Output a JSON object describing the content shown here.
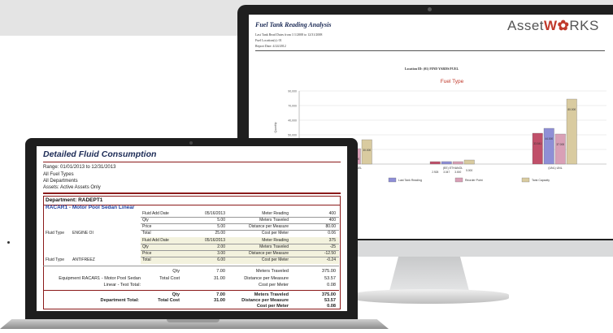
{
  "monitor": {
    "report": {
      "title": "Fuel Tank Reading Analysis",
      "meta": [
        "Last Tank Read Dates from 1/1/2008 to 12/31/2008",
        "Fuel Location(s): 01",
        "Report Date: 4/24/2012"
      ],
      "location": "Location ID: (01) FIND YARDS/FUEL",
      "logo_prefix": "Asset",
      "logo_w": "W",
      "logo_suffix": "RKS"
    },
    "chart_data": {
      "type": "bar",
      "title": "Fuel Type",
      "ylabel": "Quantity",
      "ylim": [
        0,
        90000
      ],
      "yticks": [
        "90,000",
        "70,000",
        "40,000",
        "50,000",
        "30,000"
      ],
      "categories": [
        "(BD) BIO-DIESEL",
        "(EE) ETHANOL",
        "(UNL) UNL"
      ],
      "series": [
        {
          "name": "Quantity on Hand",
          "color": "#c0506a",
          "values": [
            22000,
            3000,
            38000
          ]
        },
        {
          "name": "Last Tank Reading",
          "color": "#8f8fd6",
          "values": [
            24000,
            3047,
            44000
          ]
        },
        {
          "name": "Reorder Point",
          "color": "#d9a0b6",
          "values": [
            19000,
            3000,
            37000
          ]
        },
        {
          "name": "Tank Capacity",
          "color": "#d9cba0",
          "values": [
            30000,
            5000,
            80000
          ]
        }
      ],
      "data_labels": [
        [
          "",
          "4.504",
          "18.000",
          "30.000"
        ],
        [
          "2.928",
          "3.047",
          "3.000",
          "5.000"
        ],
        [
          "33.541",
          "44.000",
          "37.000",
          "80.000"
        ]
      ]
    }
  },
  "laptop": {
    "title": "Detailed Fluid Consumption",
    "range": "Range: 01/01/2013 to 12/31/2013",
    "fuel_types": "All Fuel Types",
    "departments": "All Departments",
    "assets": "Assets:  Active Assets Only",
    "department": "Department:  RADEPT1",
    "equipment": "RACAR1 - Motor Pool Sedan Linear",
    "block1": {
      "rows": [
        [
          "Fluid Add Date",
          "05/16/2013",
          "Meter Reading",
          "400"
        ],
        [
          "Qty",
          "5.00",
          "Meters Traveled",
          "400"
        ],
        [
          "Price",
          "5.00",
          "Distance per Measure",
          "80.00"
        ],
        [
          "Total",
          "25.00",
          "Cost per Meter",
          "0.06"
        ]
      ],
      "fluid_type_label": "Fluid Type",
      "fluid_type": "ENGINE OI"
    },
    "block2": {
      "rows": [
        [
          "Fluid Add Date",
          "05/16/2013",
          "Meter Reading",
          "375"
        ],
        [
          "Qty",
          "2.00",
          "Meters Traveled",
          "-25"
        ],
        [
          "Price",
          "3.00",
          "Distance per Measure",
          "-12.50"
        ],
        [
          "Total",
          "6.00",
          "Cost per Meter",
          "-0.24"
        ]
      ],
      "fluid_type_label": "Fluid Type",
      "fluid_type": "ANTIFREEZ"
    },
    "equip_total": {
      "label_line1": "Equipment RACAR1 - Motor Pool Sedan",
      "label_line2": "Linear - Test Total:",
      "rows": [
        [
          "Qty",
          "7.00",
          "Meters Traveled",
          "375.00"
        ],
        [
          "Total Cost",
          "31.00",
          "Distance per Measure",
          "53.57"
        ],
        [
          "",
          "",
          "Cost per Meter",
          "0.08"
        ]
      ]
    },
    "dept_total": {
      "label": "Department  Total:",
      "rows": [
        [
          "Qty",
          "7.00",
          "Meters Traveled",
          "375.00"
        ],
        [
          "Total Cost",
          "31.00",
          "Distance per Measure",
          "53.57"
        ],
        [
          "",
          "",
          "Cost per Meter",
          "0.08"
        ]
      ]
    }
  }
}
